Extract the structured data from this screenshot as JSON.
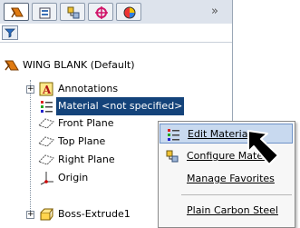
{
  "toolbar": {
    "tabs": [
      {
        "icon": "feature-manager-icon"
      },
      {
        "icon": "property-manager-icon"
      },
      {
        "icon": "configuration-manager-icon"
      },
      {
        "icon": "dimxpert-icon"
      },
      {
        "icon": "display-manager-icon"
      }
    ],
    "more": "»"
  },
  "tree": {
    "root": "WING BLANK  (Default)",
    "items": [
      {
        "label": "Annotations",
        "icon": "annotations-icon"
      },
      {
        "label": "Material <not specified>",
        "icon": "material-icon"
      },
      {
        "label": "Front Plane",
        "icon": "plane-icon"
      },
      {
        "label": "Top Plane",
        "icon": "plane-icon"
      },
      {
        "label": "Right Plane",
        "icon": "plane-icon"
      },
      {
        "label": "Origin",
        "icon": "origin-icon"
      },
      {
        "label": "Boss-Extrude1",
        "icon": "extrude-icon"
      }
    ]
  },
  "context_menu": {
    "items": [
      {
        "label": "Edit Material",
        "icon": "material-icon"
      },
      {
        "label": "Configure Materi",
        "icon": "configure-icon"
      },
      {
        "label": "Manage Favorites"
      },
      {
        "label": "Plain Carbon Steel"
      }
    ]
  },
  "colors": {
    "selection": "#14437a",
    "menu_highlight": "#c8d9ef",
    "toolbar_bg": "#dde3ec"
  }
}
